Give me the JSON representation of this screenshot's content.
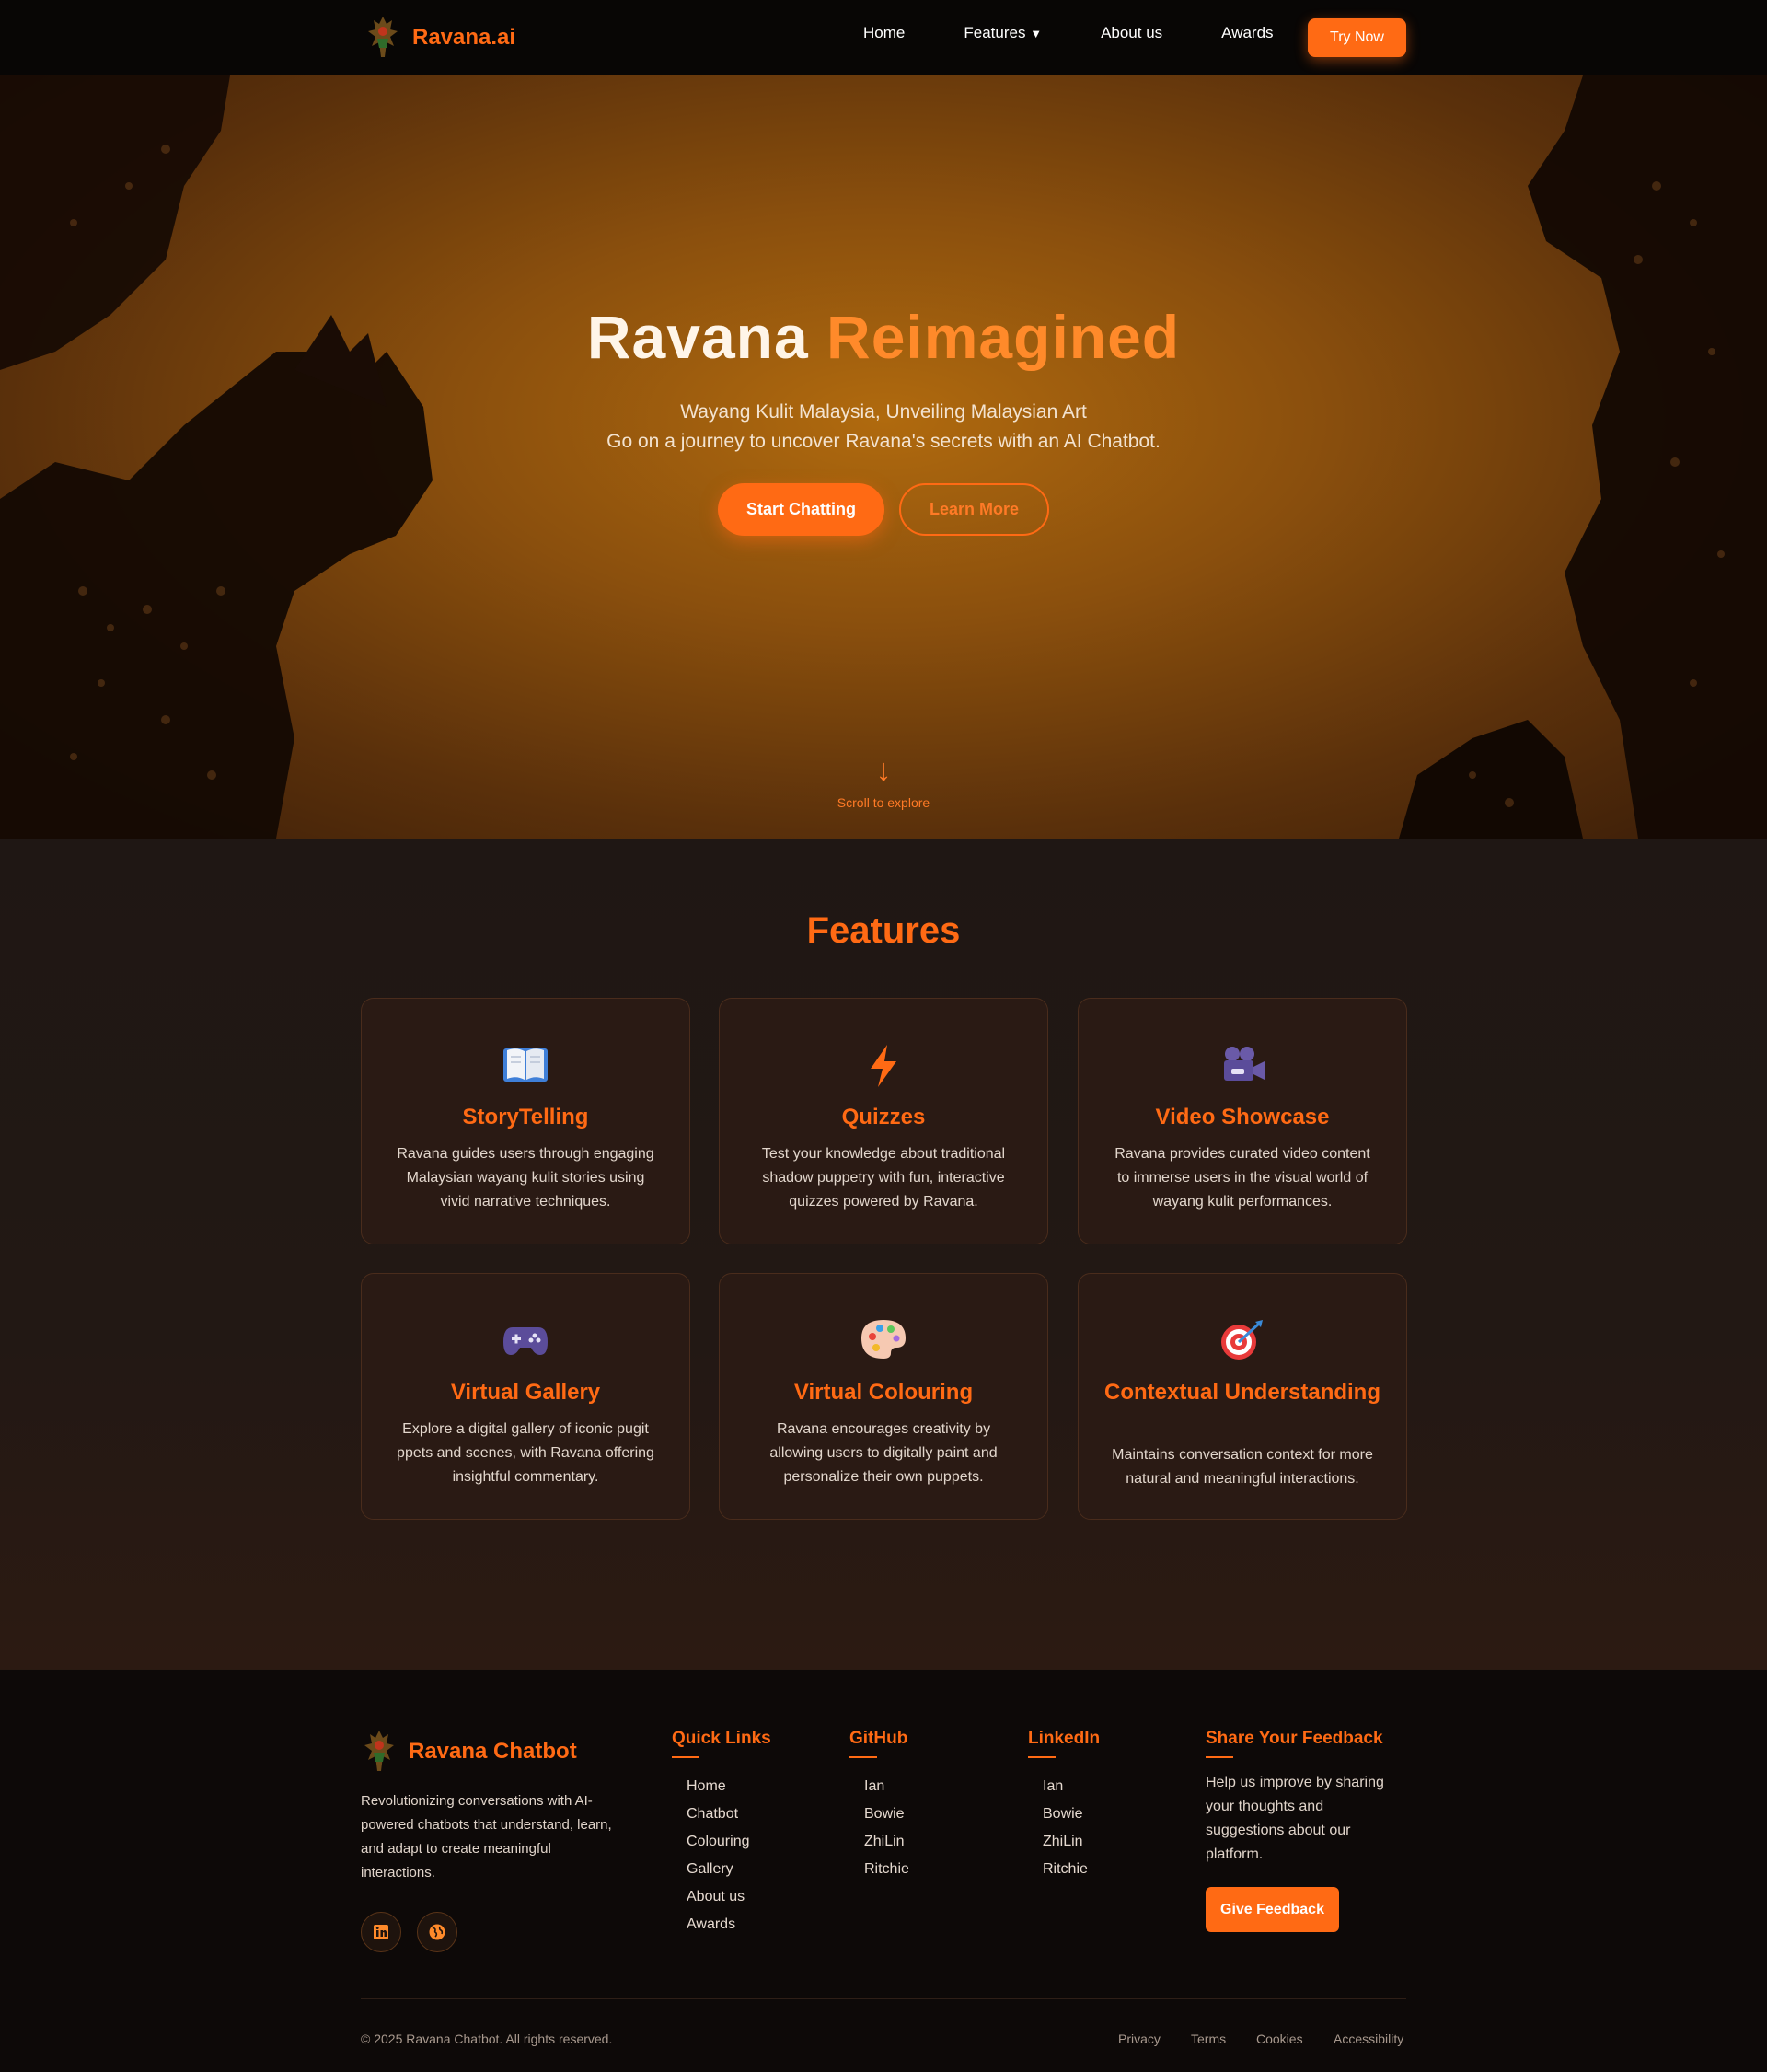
{
  "nav": {
    "brand": "Ravana.ai",
    "links": [
      "Home",
      "Features",
      "About us",
      "Awards"
    ],
    "features_caret": "▼",
    "cta": "Try Now"
  },
  "hero": {
    "title_part1": "Ravana",
    "title_part2": "Reimagined",
    "subtitle_line1": "Wayang Kulit Malaysia, Unveiling Malaysian Art",
    "subtitle_line2": "Go on a journey to uncover Ravana's secrets with an AI Chatbot.",
    "primary_button": "Start Chatting",
    "secondary_button": "Learn More",
    "scroll_arrow": "↓",
    "scroll_text": "Scroll to explore"
  },
  "features": {
    "title": "Features",
    "cards": [
      {
        "icon": "book-icon",
        "title": "StoryTelling",
        "description": "Ravana guides users through engaging Malaysian wayang kulit stories using vivid narrative techniques."
      },
      {
        "icon": "lightning-icon",
        "title": "Quizzes",
        "description": "Test your knowledge about traditional shadow puppetry with fun, interactive quizzes powered by Ravana."
      },
      {
        "icon": "video-camera-icon",
        "title": "Video Showcase",
        "description": "Ravana provides curated video content to immerse users in the visual world of wayang kulit performances."
      },
      {
        "icon": "gamepad-icon",
        "title": "Virtual Gallery",
        "description": "Explore a digital gallery of iconic pugit ppets and scenes, with Ravana offering insightful commentary."
      },
      {
        "icon": "palette-icon",
        "title": "Virtual Colouring",
        "description": "Ravana encourages creativity by allowing users to digitally paint and personalize their own puppets."
      },
      {
        "icon": "target-icon",
        "title": "Contextual Understanding",
        "description": "Maintains conversation context for more natural and meaningful interactions."
      }
    ]
  },
  "footer": {
    "brand": "Ravana Chatbot",
    "description": "Revolutionizing conversations with AI-powered chatbots that understand, learn, and adapt to create meaningful interactions.",
    "social_icons": [
      "linkedin-icon",
      "globe-icon"
    ],
    "quick_links": {
      "title": "Quick Links",
      "items": [
        "Home",
        "Chatbot",
        "Colouring",
        "Gallery",
        "About us",
        "Awards"
      ]
    },
    "github": {
      "title": "GitHub",
      "items": [
        "Ian",
        "Bowie",
        "ZhiLin",
        "Ritchie"
      ]
    },
    "linkedin": {
      "title": "LinkedIn",
      "items": [
        "Ian",
        "Bowie",
        "ZhiLin",
        "Ritchie"
      ]
    },
    "feedback": {
      "title": "Share Your Feedback",
      "text": "Help us improve by sharing your thoughts and suggestions about our platform.",
      "button": "Give Feedback"
    },
    "copyright": "© 2025 Ravana Chatbot. All rights reserved.",
    "legal": [
      "Privacy",
      "Terms",
      "Cookies",
      "Accessibility"
    ]
  },
  "colors": {
    "accent": "#ff6a14",
    "background": "#1a1210",
    "nav_bg": "#080605"
  }
}
